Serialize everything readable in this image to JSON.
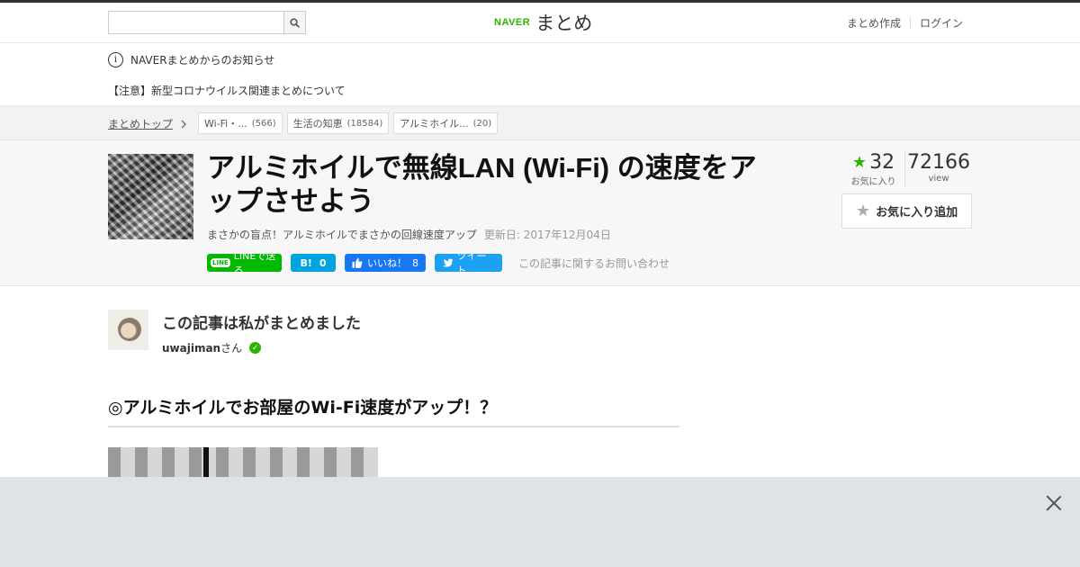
{
  "header": {
    "search_placeholder": "",
    "logo_naver": "NAVER",
    "logo_matome": "まとめ",
    "links": [
      "まとめ作成",
      "ログイン"
    ]
  },
  "notice": {
    "heading": "NAVERまとめからのお知らせ",
    "item": "【注意】新型コロナウイルス関連まとめについて"
  },
  "breadcrumb": {
    "top": "まとめトップ",
    "tags": [
      {
        "label": "Wi-Fi・...",
        "count": "(566)"
      },
      {
        "label": "生活の知恵",
        "count": "(18584)"
      },
      {
        "label": "アルミホイル...",
        "count": "(20)"
      }
    ]
  },
  "article": {
    "title": "アルミホイルで無線LAN (Wi-Fi) の速度をアップさせよう",
    "subtitle": "まさかの盲点！アルミホイルでまさかの回線速度アップ",
    "updated": "更新日: 2017年12月04日",
    "share": {
      "line": "LINEで送る",
      "line_badge": "LINE",
      "hatena": "B!",
      "hatena_count": "0",
      "fb": "いいね！",
      "fb_count": "8",
      "tweet": "ツイート"
    },
    "contact": "この記事に関するお問い合わせ",
    "favorites": "32",
    "favorites_label": "お気に入り",
    "views": "72166",
    "views_label": "view",
    "fav_button": "お気に入り追加"
  },
  "author": {
    "heading": "この記事は私がまとめました",
    "name": "uwajiman",
    "suffix": "さん"
  },
  "section": {
    "heading": "◎アルミホイルでお部屋のWi-Fi速度がアップ！？"
  }
}
